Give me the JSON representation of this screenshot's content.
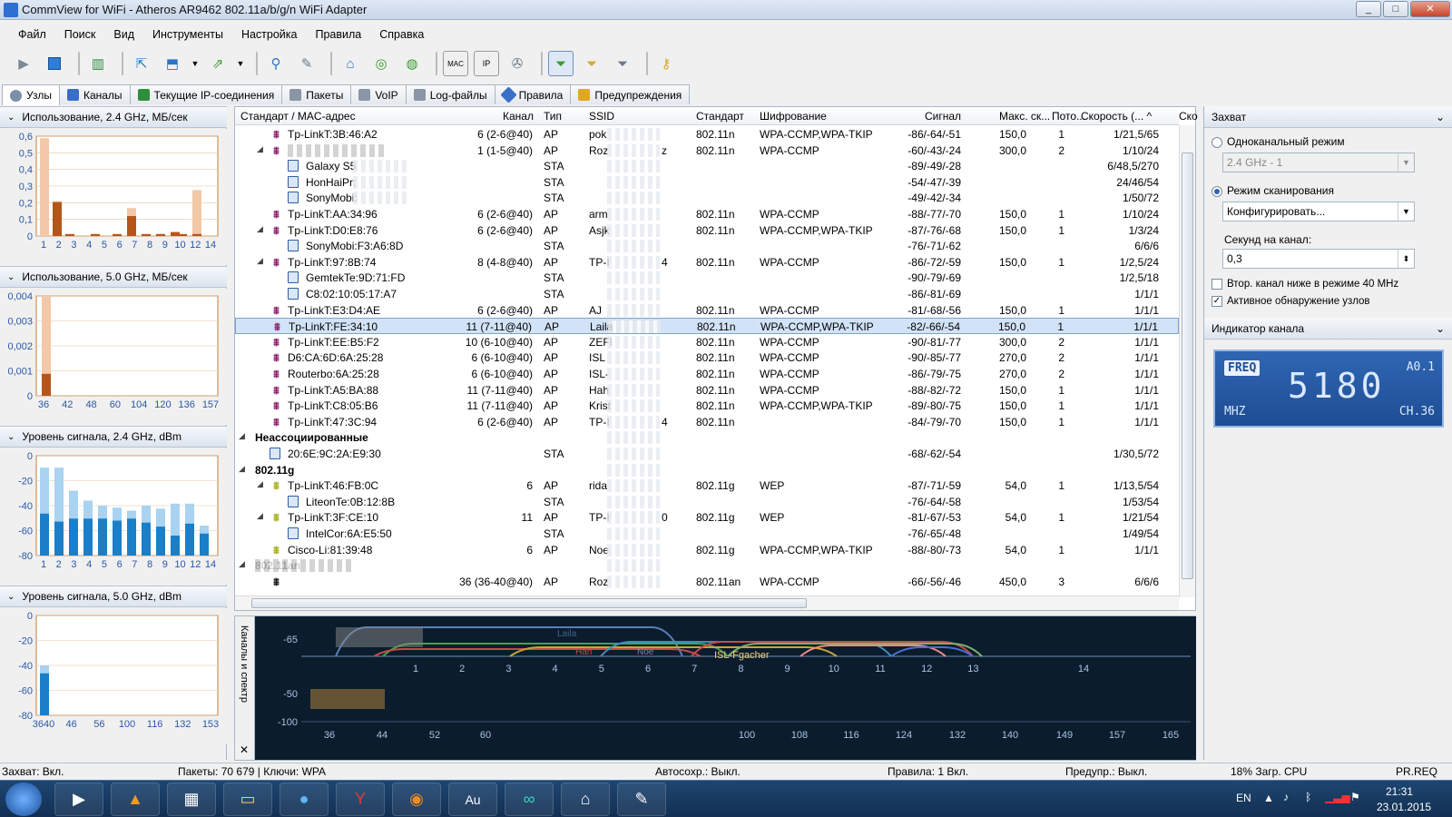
{
  "window": {
    "title": "CommView for WiFi - Atheros AR9462 802.11a/b/g/n WiFi Adapter",
    "min": "_",
    "max": "□",
    "close": "✕"
  },
  "menu": [
    "Файл",
    "Поиск",
    "Вид",
    "Инструменты",
    "Настройка",
    "Правила",
    "Справка"
  ],
  "toolbar": {
    "icons": [
      "play-icon",
      "stop-icon",
      "map-icon",
      "open-icon",
      "save-icon",
      "save-dropdown-icon",
      "export-icon",
      "export-dropdown-icon",
      "search-icon",
      "edit-icon",
      "node-icon",
      "reconstruct-icon",
      "stats-icon",
      "mac-alias-icon",
      "ip-alias-icon",
      "settings-icon",
      "filter-active-icon",
      "filter-mac-icon",
      "filter-ip-icon",
      "key-icon"
    ]
  },
  "tabs": [
    "Узлы",
    "Каналы",
    "Текущие IP-соединения",
    "Пакеты",
    "VoIP",
    "Log-файлы",
    "Правила",
    "Предупреждения"
  ],
  "left": {
    "u24": {
      "title": "Использование, 2.4 GHz, МБ/сек",
      "yticks": [
        "0,6",
        "0,5",
        "0,4",
        "0,3",
        "0,2",
        "0,1",
        "0"
      ],
      "xticks": [
        "1",
        "2",
        "3",
        "4",
        "5",
        "6",
        "7",
        "8",
        "9",
        "10",
        "12",
        "14"
      ]
    },
    "u50": {
      "title": "Использование, 5.0 GHz, МБ/сек",
      "yticks": [
        "0,004",
        "0,003",
        "0,002",
        "0,001",
        "0"
      ],
      "xticks": [
        "36",
        "42",
        "48",
        "60",
        "104",
        "120",
        "136",
        "157"
      ]
    },
    "s24": {
      "title": "Уровень сигнала, 2.4 GHz, dBm",
      "yticks": [
        "0",
        "-20",
        "-40",
        "-60",
        "-80"
      ],
      "xticks": [
        "1",
        "2",
        "3",
        "4",
        "5",
        "6",
        "7",
        "8",
        "9",
        "10",
        "12",
        "14"
      ]
    },
    "s50": {
      "title": "Уровень сигнала, 5.0 GHz, dBm",
      "yticks": [
        "0",
        "-20",
        "-40",
        "-60",
        "-80"
      ],
      "xticks": [
        "3640",
        "46",
        "56",
        "100",
        "116",
        "132",
        "153"
      ]
    }
  },
  "table": {
    "headers": [
      "Стандарт / MAC-адрес",
      "Канал",
      "Тип",
      "SSID",
      "Стандарт",
      "Шифрование",
      "Сигнал",
      "Макс. ск...",
      "Пото...",
      "Скорость (... ^",
      "Ско"
    ],
    "rows": [
      {
        "lvl": 1,
        "exp": "",
        "icon": "ap",
        "mac": "Tp-LinkT:3B:46:A2",
        "ch": "6 (2-6@40)",
        "type": "AP",
        "ssid": "pok",
        "std": "802.11n",
        "enc": "WPA-CCMP,WPA-TKIP",
        "sig": "-86/-64/-51",
        "max": "150,0",
        "str": "1",
        "spd": "1/21,5/65"
      },
      {
        "lvl": 1,
        "exp": "◢",
        "icon": "ap",
        "mac": "",
        "ch": "1 (1-5@40)",
        "type": "AP",
        "ssid": "Roz",
        "ssid2": "z",
        "std": "802.11n",
        "enc": "WPA-CCMP",
        "sig": "-60/-43/-24",
        "max": "300,0",
        "str": "2",
        "spd": "1/10/24"
      },
      {
        "lvl": 2,
        "icon": "sta",
        "mac": "Galaxy S5",
        "ch": "",
        "type": "STA",
        "ssid": "",
        "std": "",
        "enc": "",
        "sig": "-89/-49/-28",
        "max": "",
        "str": "",
        "spd": "6/48,5/270"
      },
      {
        "lvl": 2,
        "icon": "sta",
        "mac": "HonHaiPr:",
        "ch": "",
        "type": "STA",
        "ssid": "",
        "std": "",
        "enc": "",
        "sig": "-54/-47/-39",
        "max": "",
        "str": "",
        "spd": "24/46/54"
      },
      {
        "lvl": 2,
        "icon": "sta",
        "mac": "SonyMobi:",
        "ch": "",
        "type": "STA",
        "ssid": "",
        "std": "",
        "enc": "",
        "sig": "-49/-42/-34",
        "max": "",
        "str": "",
        "spd": "1/50/72"
      },
      {
        "lvl": 1,
        "exp": "",
        "icon": "ap",
        "mac": "Tp-LinkT:AA:34:96",
        "ch": "6 (2-6@40)",
        "type": "AP",
        "ssid": "arm",
        "std": "802.11n",
        "enc": "WPA-CCMP",
        "sig": "-88/-77/-70",
        "max": "150,0",
        "str": "1",
        "spd": "1/10/24"
      },
      {
        "lvl": 1,
        "exp": "◢",
        "icon": "ap",
        "mac": "Tp-LinkT:D0:E8:76",
        "ch": "6 (2-6@40)",
        "type": "AP",
        "ssid": "Asjk",
        "std": "802.11n",
        "enc": "WPA-CCMP,WPA-TKIP",
        "sig": "-87/-76/-68",
        "max": "150,0",
        "str": "1",
        "spd": "1/3/24"
      },
      {
        "lvl": 2,
        "icon": "sta",
        "mac": "SonyMobi:F3:A6:8D",
        "ch": "",
        "type": "STA",
        "ssid": "",
        "std": "",
        "enc": "",
        "sig": "-76/-71/-62",
        "max": "",
        "str": "",
        "spd": "6/6/6"
      },
      {
        "lvl": 1,
        "exp": "◢",
        "icon": "ap",
        "mac": "Tp-LinkT:97:8B:74",
        "ch": "8 (4-8@40)",
        "type": "AP",
        "ssid": "TP-I",
        "ssid2": "4",
        "std": "802.11n",
        "enc": "WPA-CCMP",
        "sig": "-86/-72/-59",
        "max": "150,0",
        "str": "1",
        "spd": "1/2,5/24"
      },
      {
        "lvl": 2,
        "icon": "sta",
        "mac": "GemtekTe:9D:71:FD",
        "ch": "",
        "type": "STA",
        "ssid": "",
        "std": "",
        "enc": "",
        "sig": "-90/-79/-69",
        "max": "",
        "str": "",
        "spd": "1/2,5/18"
      },
      {
        "lvl": 2,
        "icon": "sta",
        "mac": "C8:02:10:05:17:A7",
        "ch": "",
        "type": "STA",
        "ssid": "",
        "std": "",
        "enc": "",
        "sig": "-86/-81/-69",
        "max": "",
        "str": "",
        "spd": "1/1/1"
      },
      {
        "lvl": 1,
        "exp": "",
        "icon": "ap",
        "mac": "Tp-LinkT:E3:D4:AE",
        "ch": "6 (2-6@40)",
        "type": "AP",
        "ssid": "AJ",
        "std": "802.11n",
        "enc": "WPA-CCMP",
        "sig": "-81/-68/-56",
        "max": "150,0",
        "str": "1",
        "spd": "1/1/1"
      },
      {
        "lvl": 1,
        "exp": "",
        "icon": "ap",
        "sel": true,
        "mac": "Tp-LinkT:FE:34:10",
        "ch": "11 (7-11@40)",
        "type": "AP",
        "ssid": "Laila",
        "std": "802.11n",
        "enc": "WPA-CCMP,WPA-TKIP",
        "sig": "-82/-66/-54",
        "max": "150,0",
        "str": "1",
        "spd": "1/1/1"
      },
      {
        "lvl": 1,
        "exp": "",
        "icon": "ap",
        "mac": "Tp-LinkT:EE:B5:F2",
        "ch": "10 (6-10@40)",
        "type": "AP",
        "ssid": "ZEFI",
        "std": "802.11n",
        "enc": "WPA-CCMP",
        "sig": "-90/-81/-77",
        "max": "300,0",
        "str": "2",
        "spd": "1/1/1"
      },
      {
        "lvl": 1,
        "exp": "",
        "icon": "ap",
        "mac": "D6:CA:6D:6A:25:28",
        "ch": "6 (6-10@40)",
        "type": "AP",
        "ssid": "ISL",
        "std": "802.11n",
        "enc": "WPA-CCMP",
        "sig": "-90/-85/-77",
        "max": "270,0",
        "str": "2",
        "spd": "1/1/1"
      },
      {
        "lvl": 1,
        "exp": "",
        "icon": "ap",
        "mac": "Routerbo:6A:25:28",
        "ch": "6 (6-10@40)",
        "type": "AP",
        "ssid": "ISL-",
        "std": "802.11n",
        "enc": "WPA-CCMP",
        "sig": "-86/-79/-75",
        "max": "270,0",
        "str": "2",
        "spd": "1/1/1"
      },
      {
        "lvl": 1,
        "exp": "",
        "icon": "ap",
        "mac": "Tp-LinkT:A5:BA:88",
        "ch": "11 (7-11@40)",
        "type": "AP",
        "ssid": "Hah",
        "std": "802.11n",
        "enc": "WPA-CCMP",
        "sig": "-88/-82/-72",
        "max": "150,0",
        "str": "1",
        "spd": "1/1/1"
      },
      {
        "lvl": 1,
        "exp": "",
        "icon": "ap",
        "mac": "Tp-LinkT:C8:05:B6",
        "ch": "11 (7-11@40)",
        "type": "AP",
        "ssid": "Krist",
        "std": "802.11n",
        "enc": "WPA-CCMP,WPA-TKIP",
        "sig": "-89/-80/-75",
        "max": "150,0",
        "str": "1",
        "spd": "1/1/1"
      },
      {
        "lvl": 1,
        "exp": "",
        "icon": "ap",
        "mac": "Tp-LinkT:47:3C:94",
        "ch": "6 (2-6@40)",
        "type": "AP",
        "ssid": "TP-I",
        "ssid2": "4",
        "std": "802.11n",
        "enc": "",
        "sig": "-84/-79/-70",
        "max": "150,0",
        "str": "1",
        "spd": "1/1/1"
      },
      {
        "lvl": 0,
        "exp": "◢",
        "icon": "",
        "mac": "Неассоциированные",
        "bold": true
      },
      {
        "lvl": 1,
        "icon": "sta",
        "mac": "20:6E:9C:2A:E9:30",
        "ch": "",
        "type": "STA",
        "ssid": "",
        "std": "",
        "enc": "",
        "sig": "-68/-62/-54",
        "max": "",
        "str": "",
        "spd": "1/30,5/72"
      },
      {
        "lvl": 0,
        "exp": "◢",
        "icon": "",
        "mac": "802.11g",
        "bold": true
      },
      {
        "lvl": 1,
        "exp": "◢",
        "icon": "apg",
        "mac": "Tp-LinkT:46:FB:0C",
        "ch": "6",
        "type": "AP",
        "ssid": "rida",
        "std": "802.11g",
        "enc": "WEP",
        "sig": "-87/-71/-59",
        "max": "54,0",
        "str": "1",
        "spd": "1/13,5/54"
      },
      {
        "lvl": 2,
        "icon": "sta",
        "mac": "LiteonTe:0B:12:8B",
        "ch": "",
        "type": "STA",
        "ssid": "",
        "std": "",
        "enc": "",
        "sig": "-76/-64/-58",
        "max": "",
        "str": "",
        "spd": "1/53/54"
      },
      {
        "lvl": 1,
        "exp": "◢",
        "icon": "apg",
        "mac": "Tp-LinkT:3F:CE:10",
        "ch": "11",
        "type": "AP",
        "ssid": "TP-I",
        "ssid2": "0",
        "std": "802.11g",
        "enc": "WEP",
        "sig": "-81/-67/-53",
        "max": "54,0",
        "str": "1",
        "spd": "1/21/54"
      },
      {
        "lvl": 2,
        "icon": "sta",
        "mac": "IntelCor:6A:E5:50",
        "ch": "",
        "type": "STA",
        "ssid": "",
        "std": "",
        "enc": "",
        "sig": "-76/-65/-48",
        "max": "",
        "str": "",
        "spd": "1/49/54"
      },
      {
        "lvl": 1,
        "exp": "",
        "icon": "apg",
        "mac": "Cisco-Li:81:39:48",
        "ch": "6",
        "type": "AP",
        "ssid": "Noe",
        "std": "802.11g",
        "enc": "WPA-CCMP,WPA-TKIP",
        "sig": "-88/-80/-73",
        "max": "54,0",
        "str": "1",
        "spd": "1/1/1"
      },
      {
        "lvl": 0,
        "exp": "◢",
        "icon": "",
        "mac": "802.11an",
        "bold": true
      },
      {
        "lvl": 1,
        "exp": "",
        "icon": "apan",
        "mac": "",
        "ch": "36 (36-40@40)",
        "type": "AP",
        "ssid": "Roz",
        "std": "802.11an",
        "enc": "WPA-CCMP",
        "sig": "-66/-56/-46",
        "max": "450,0",
        "str": "3",
        "spd": "6/6/6"
      }
    ]
  },
  "right": {
    "capture": "Захват",
    "single": "Одноканальный режим",
    "single_combo": "2.4 GHz - 1",
    "scan": "Режим сканирования",
    "scan_combo": "Конфигурировать...",
    "sec_label": "Секунд на канал:",
    "sec_value": "0,3",
    "chk1": "Втор. канал ниже в режиме 40 MHz",
    "chk2": "Активное обнаружение узлов",
    "indicator": "Индикатор канала",
    "freq_tag": "FREQ",
    "freq_a": "A0.1",
    "freq_val": "5180",
    "freq_unit": "MHZ",
    "freq_ch": "CH.36"
  },
  "spectrum": {
    "side_label": "Каналы и спектр",
    "ticks24": [
      "1",
      "2",
      "3",
      "4",
      "5",
      "6",
      "7",
      "8",
      "9",
      "10",
      "11",
      "12",
      "13",
      "14"
    ],
    "ticks5": [
      "36",
      "44",
      "52",
      "60",
      "100",
      "108",
      "116",
      "124",
      "132",
      "140",
      "149",
      "157",
      "165"
    ],
    "yt1": "-65",
    "yt2": "-50",
    "yt3": "-100",
    "labels": [
      "Laila",
      "Hah",
      "ISL-Fgacher",
      "Noe"
    ]
  },
  "status": {
    "capture": "Захват: Вкл.",
    "packets": "Пакеты: 70 679 | Ключи: WPA",
    "autosave": "Автосохр.: Выкл.",
    "rules": "Правила: 1 Вкл.",
    "warn": "Предупр.: Выкл.",
    "cpu": "18% Загр. CPU",
    "prreq": "PR.REQ"
  },
  "taskbar": {
    "lang": "EN",
    "time": "21:31",
    "date": "23.01.2015"
  },
  "colors": {
    "accent": "#2e63b8",
    "bar24": "#b5551a",
    "bar24light": "#f2c8a8",
    "sig": "#1a7fc8",
    "siglight": "#a9d3f0",
    "ap": "#8c1f6e",
    "apg": "#a8b014"
  }
}
